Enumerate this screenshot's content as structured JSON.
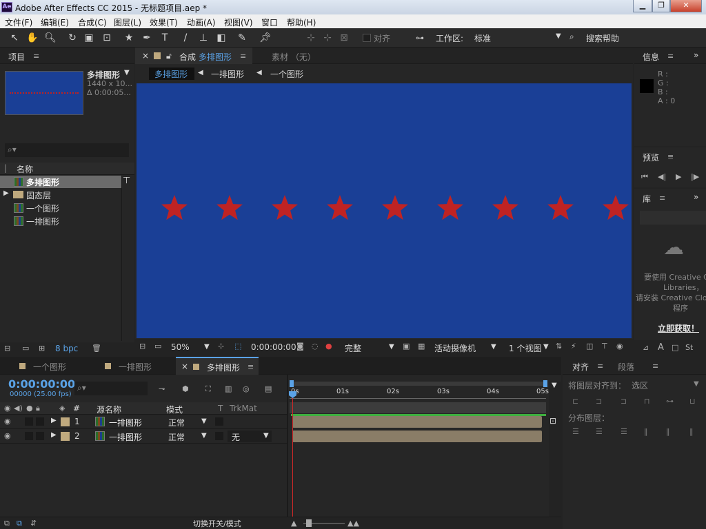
{
  "window": {
    "title": "Adobe After Effects CC 2015 - 无标题项目.aep *",
    "app_badge": "Ae"
  },
  "menu": [
    "文件(F)",
    "编辑(E)",
    "合成(C)",
    "图层(L)",
    "效果(T)",
    "动画(A)",
    "视图(V)",
    "窗口",
    "帮助(H)"
  ],
  "toolbar": {
    "snap_label": "对齐",
    "workspace_label": "工作区:",
    "workspace_value": "标准",
    "search_help": "搜索帮助"
  },
  "project": {
    "tab": "项目",
    "selected_name": "多排图形",
    "selected_dims": "1440 x 10...",
    "selected_duration": "Δ 0:00:05...",
    "column_name": "名称",
    "items": [
      {
        "name": "多排图形",
        "type": "comp",
        "selected": true
      },
      {
        "name": "固态层",
        "type": "folder",
        "selected": false
      },
      {
        "name": "一个图形",
        "type": "comp",
        "selected": false
      },
      {
        "name": "一排图形",
        "type": "comp",
        "selected": false
      }
    ],
    "bpc": "8 bpc"
  },
  "composition": {
    "tab_prefix": "合成",
    "tab_name": "多排图形",
    "footage_tab": "素材 （无）",
    "breadcrumbs": [
      "多排图形",
      "一排图形",
      "一个图形"
    ],
    "bg_color": "#1a3f96",
    "star_color": "#bf2323",
    "star_count": 9,
    "zoom": "50%",
    "timecode": "0:00:00:00",
    "resolution": "完整",
    "camera": "活动摄像机",
    "views": "1 个视图"
  },
  "info": {
    "tab": "信息",
    "r": "R :",
    "g": "G :",
    "b": "B :",
    "a": "A : 0"
  },
  "preview": {
    "tab": "预览"
  },
  "library": {
    "tab": "库",
    "msg1": "要使用 Creative Cl",
    "msg2": "Libraries，",
    "msg3": "请安装 Creative Clou",
    "msg4": "程序",
    "link": "立即获取！"
  },
  "align": {
    "tab": "对齐",
    "tab2": "段落",
    "align_to_label": "将图层对齐到：",
    "align_to_value": "选区",
    "distribute_label": "分布图层："
  },
  "timeline": {
    "tabs": [
      "一个图形",
      "一排图形",
      "多排图形"
    ],
    "timecode": "0:00:00:00",
    "fps": "00000 (25.00 fps)",
    "col_num": "#",
    "col_source": "源名称",
    "col_mode": "模式",
    "col_t": "T",
    "col_trkmat": "TrkMat",
    "ruler": [
      "0s",
      "01s",
      "02s",
      "03s",
      "04s",
      "05s"
    ],
    "layers": [
      {
        "num": "1",
        "name": "一排图形",
        "mode": "正常",
        "trkmat": ""
      },
      {
        "num": "2",
        "name": "一排图形",
        "mode": "正常",
        "trkmat": "无"
      }
    ],
    "footer": "切换开关/模式"
  }
}
